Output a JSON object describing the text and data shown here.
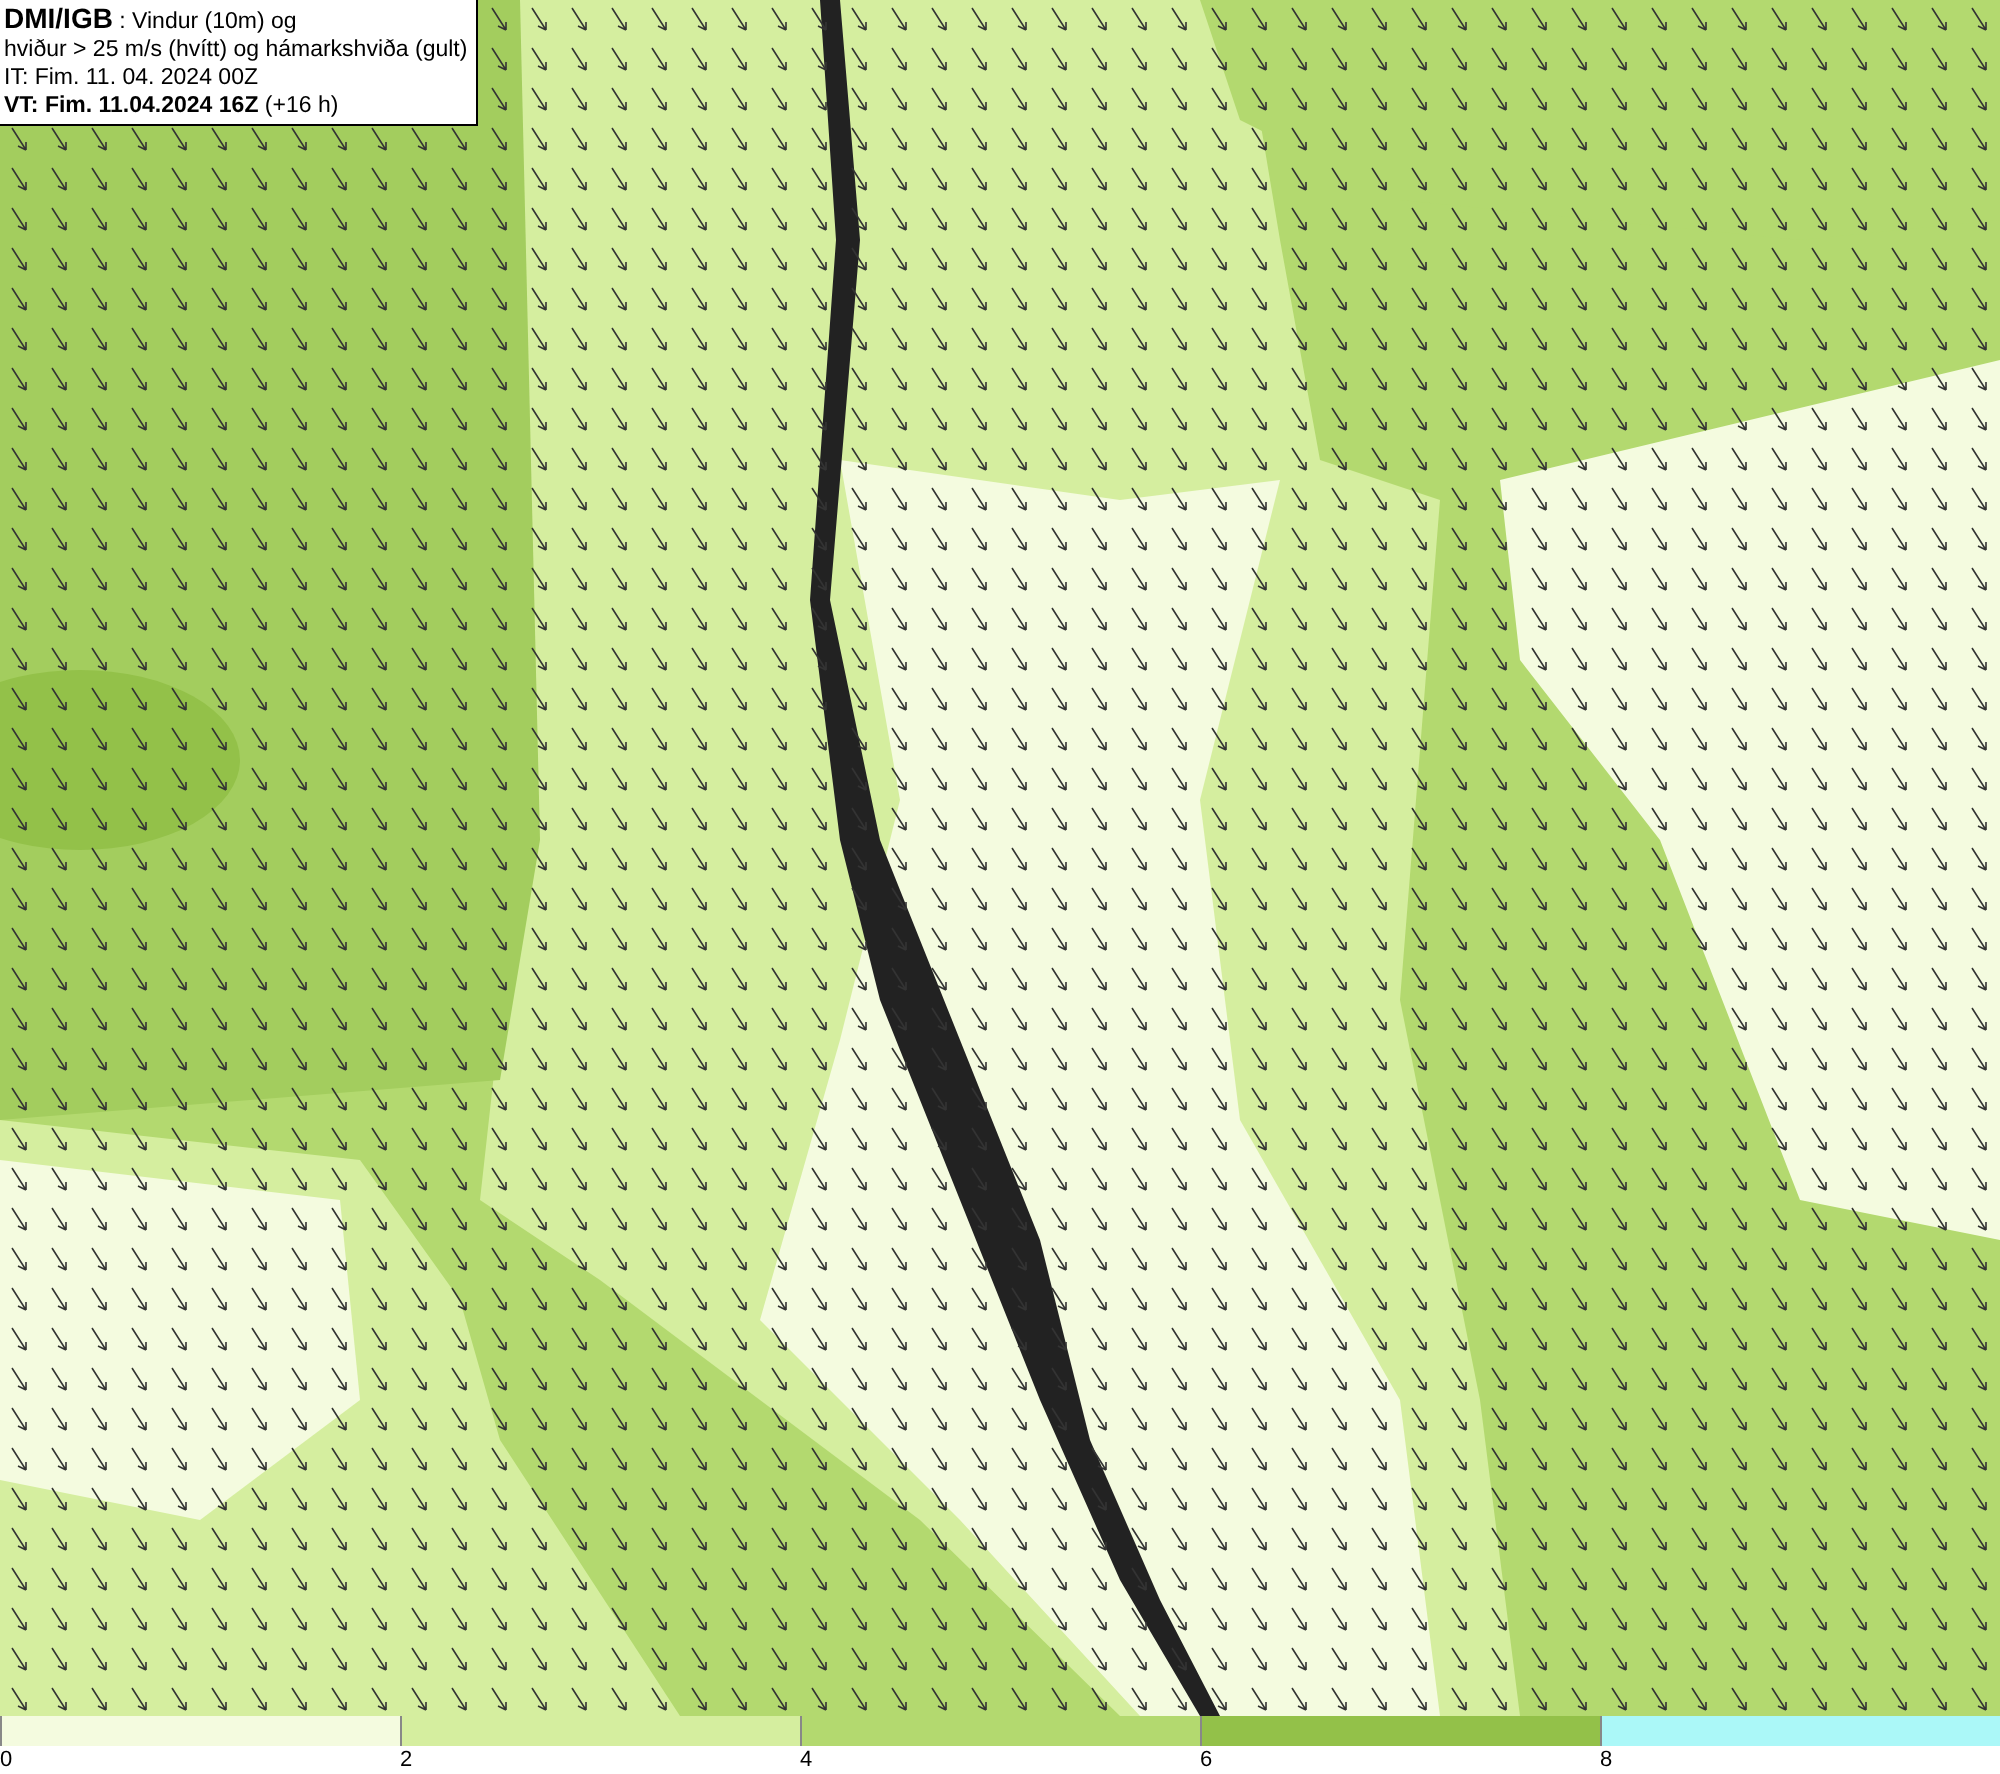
{
  "title_box": {
    "lines": [
      "**DMI/IGB** : Vindur (10m) og",
      "hviður > 25 m/s (hvítt) og hámarkshviða (gult)",
      "IT: Fim. 11. 04. 2024 00Z",
      "**VT: Fim. 11.04.2024 16Z** (+16 h)"
    ]
  },
  "legend": {
    "bins": [
      {
        "color": "#f4fbdf",
        "label": "0"
      },
      {
        "color": "#d5ee9f",
        "label": "2"
      },
      {
        "color": "#b3d96f",
        "label": "4"
      },
      {
        "color": "#93c149",
        "label": "6"
      },
      {
        "color": "#abf8f8",
        "label": "8"
      }
    ]
  }
}
